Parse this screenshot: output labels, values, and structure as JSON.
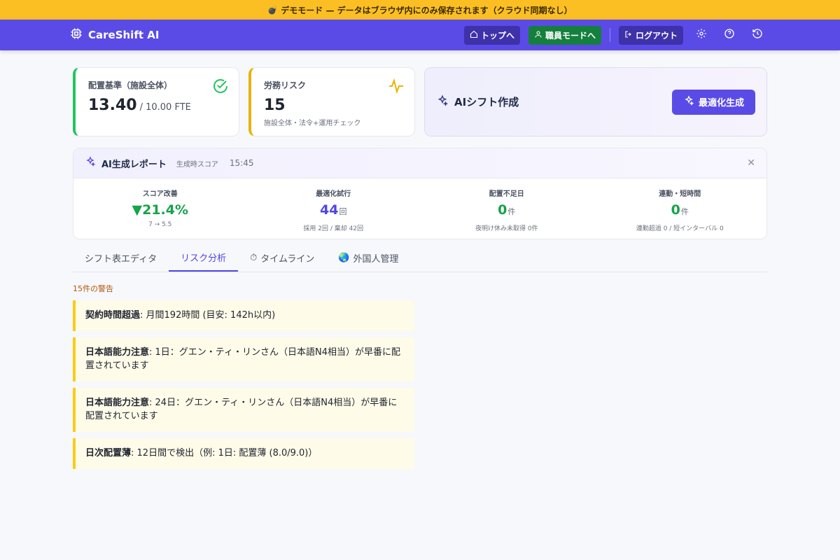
{
  "banner": {
    "icon": "bomb-icon",
    "text": "デモモード — データはブラウザ内にのみ保存されます（クラウド同期なし）"
  },
  "nav": {
    "brand": "CareShift AI",
    "top_label": "トップへ",
    "staff_mode_label": "職員モードへ",
    "logout_label": "ログアウト",
    "accent": "#5b4be6"
  },
  "stats": [
    {
      "label": "配置基準（施設全体）",
      "value": "13.40",
      "suffix": "/ 10.00 FTE",
      "color": "#22c55e",
      "icon": "check-circle-icon"
    },
    {
      "label": "労務リスク",
      "value": "15",
      "sub": "施設全体・法令+運用チェック",
      "color": "#eab308",
      "icon": "activity-icon"
    }
  ],
  "ai_card": {
    "title": "AIシフト作成",
    "button": "最適化生成"
  },
  "report": {
    "title": "AI生成レポート",
    "meta": "生成時スコア",
    "time": "15:45",
    "metrics": [
      {
        "label": "スコア改善",
        "value": "▼21.4%",
        "unit": "",
        "sub": "7 → 5.5"
      },
      {
        "label": "最適化試行",
        "value": "44",
        "unit": "回",
        "sub": "採用 2回 / 棄却 42回"
      },
      {
        "label": "配置不足日",
        "value": "0",
        "unit": "件",
        "sub": "夜明け休み未取得 0件"
      },
      {
        "label": "連勤・短時間",
        "value": "0",
        "unit": "件",
        "sub": "連勤超過 0 / 短インターバル 0"
      }
    ]
  },
  "tabs": [
    {
      "label": "シフト表エディタ",
      "icon": ""
    },
    {
      "label": "リスク分析",
      "icon": ""
    },
    {
      "label": "タイムライン",
      "icon": "⏱"
    },
    {
      "label": "外国人管理",
      "icon": "🌏"
    }
  ],
  "warnings": {
    "count_label": "15件の警告",
    "items": [
      {
        "title": "契約時間超過",
        "text": ": 月間192時間 (目安: 142h以内)"
      },
      {
        "title": "日本語能力注意",
        "text": ": 1日：グエン・ティ・リンさん（日本語N4相当）が早番に配置されています"
      },
      {
        "title": "日本語能力注意",
        "text": ": 24日：グエン・ティ・リンさん（日本語N4相当）が早番に配置されています"
      },
      {
        "title": "日次配置薄",
        "text": ": 12日間で検出（例: 1日: 配置薄 (8.0/9.0)）"
      }
    ]
  }
}
